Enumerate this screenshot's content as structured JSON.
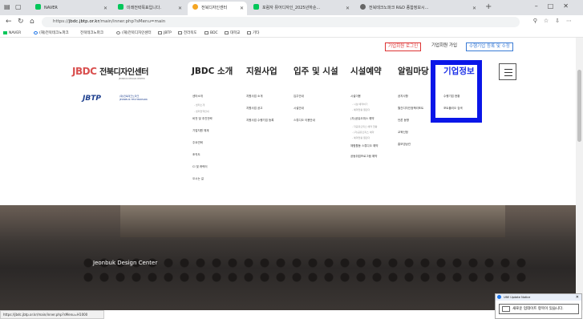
{
  "browser": {
    "tabs": [
      {
        "label": "NAVER",
        "active": false
      },
      {
        "label": "미래전략목표입니다.",
        "active": false
      },
      {
        "label": "전북디자인센터",
        "active": true
      },
      {
        "label": "포럼자 뮤어디자인_2025년하순...",
        "active": false
      },
      {
        "label": "전북테크노파크 R&D 종합정보시...",
        "active": false
      }
    ],
    "url_prefix": "https://",
    "url_host": "jbdc.jbtp.or.kr",
    "url_path": "/main/inner.php?sMenu=main",
    "bookmarks": [
      "NAVER",
      "(재)전북테크노파크",
      "전북테크노파크",
      "(재)전북디자인센터",
      "JBTP",
      "전라북도",
      "BDC",
      "대학교",
      "기타"
    ]
  },
  "header": {
    "login": "기업회원 로그인",
    "join": "기업회원 가입",
    "register": "수행기업 등록 및 수정",
    "logo_mark": "JBDC",
    "logo_kr": "전북디자인센터",
    "logo_sub": "JEONBUK DESIGN CENTER",
    "jbtp": "JBTP",
    "jbtp_kr1": "(재)전북테크노파크",
    "jbtp_kr2": "JEONBUK TECHNOPARK"
  },
  "gnb": [
    {
      "label": "JBDC 소개",
      "subs": [
        "센터소개",
        "- 센터소개",
        "- 센터연혁안내",
        "비전 및 추진전략",
        "기업지원 체계",
        "주요연혁",
        "조직도",
        "CI 및 캐릭터",
        "오시는 길"
      ]
    },
    {
      "label": "지원사업",
      "subs": [
        "지원사업 소개",
        "지원사업 공고",
        "지원사업 수행기업 등록"
      ]
    },
    {
      "label": "입주 및 시설",
      "subs": [
        "입주안내",
        "시설안내",
        "스튜디오 이용안내"
      ]
    },
    {
      "label": "시설예약",
      "subs": [
        "시설이용",
        "- 시설 예약하기",
        "- 예약현황 캘린더",
        "(자)공유오피스 예약",
        "- 자공유오피스 예약 현황",
        "- (자)공유오피스 예약",
        "- 예약현황 캘린더",
        "체험활동 스튜디오 예약",
        "공동취업프로그램 예약"
      ]
    },
    {
      "label": "알림마당",
      "subs": [
        "공지사항",
        "월간디자인정책리포트",
        "언론 동향",
        "교육신청",
        "홍보영상관"
      ]
    },
    {
      "label": "기업정보",
      "subs": [
        "수행기업 현황",
        "포트폴리오 검색"
      ]
    }
  ],
  "hero": {
    "title": "Jeonbuk Design Center"
  },
  "status_url": "https://jbdc.jbtp.or.kr/main/inner.php?sMenu=H1000",
  "notification": {
    "title": "UBE Update Notice",
    "message": "새로운 업데이트 항목이 있습니다."
  }
}
